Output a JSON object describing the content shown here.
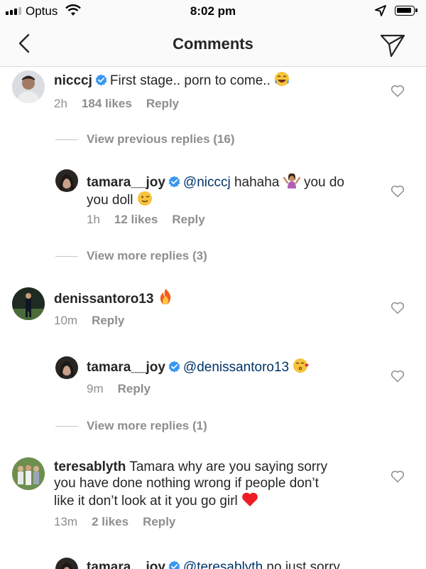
{
  "status_bar": {
    "carrier": "Optus",
    "time": "8:02 pm"
  },
  "header": {
    "title": "Comments"
  },
  "comments": [
    {
      "user": "nicccj",
      "text": "First stage.. porn to come..",
      "time": "2h",
      "likes": "184 likes",
      "reply": "Reply"
    },
    {
      "user": "tamara__joy",
      "mention": "@nicccj",
      "text_a": "hahaha",
      "text_b": "you do",
      "text_c": "you doll",
      "time": "1h",
      "likes": "12 likes",
      "reply": "Reply"
    },
    {
      "user": "denissantoro13",
      "time": "10m",
      "reply": "Reply"
    },
    {
      "user": "tamara__joy",
      "mention": "@denissantoro13",
      "time": "9m",
      "reply": "Reply"
    },
    {
      "user": "teresablyth",
      "line1": "Tamara why are you saying sorry",
      "line2": "you have done nothing wrong if people don’t",
      "line3": "like it don’t look at it you go girl",
      "time": "13m",
      "likes": "2 likes",
      "reply": "Reply"
    },
    {
      "user": "tamara__joy",
      "mention": "@teresablyth",
      "text": "no just sorry"
    }
  ],
  "view_replies": [
    "View previous replies (16)",
    "View more replies (3)",
    "View more replies (1)"
  ],
  "colors": {
    "verified": "#3897f0",
    "mention": "#003569",
    "meta": "#8e8e8e",
    "heart_red": "#ed1c24"
  }
}
